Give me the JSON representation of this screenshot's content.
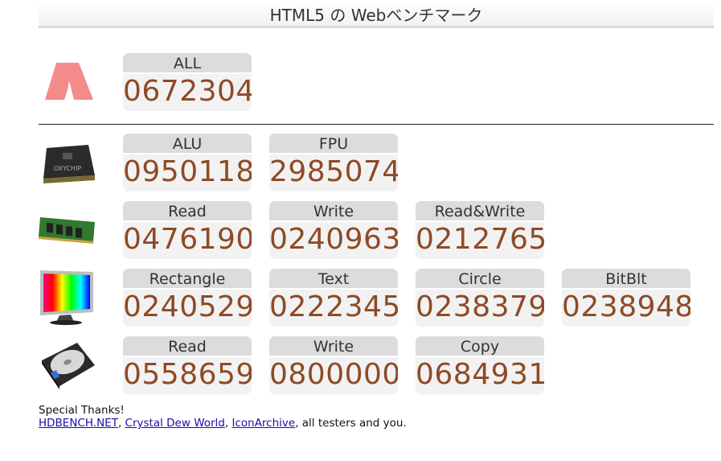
{
  "header": {
    "title": "HTML5 の Webベンチマーク"
  },
  "all": {
    "card": {
      "label": "ALL",
      "value": "0672304"
    }
  },
  "cpu": {
    "icon": "cpu-chip-icon",
    "cards": [
      {
        "label": "ALU",
        "value": "0950118"
      },
      {
        "label": "FPU",
        "value": "2985074"
      }
    ]
  },
  "memory": {
    "icon": "memory-module-icon",
    "cards": [
      {
        "label": "Read",
        "value": "0476190"
      },
      {
        "label": "Write",
        "value": "0240963"
      },
      {
        "label": "Read&Write",
        "value": "0212765"
      }
    ]
  },
  "video": {
    "icon": "monitor-icon",
    "cards": [
      {
        "label": "Rectangle",
        "value": "0240529"
      },
      {
        "label": "Text",
        "value": "0222345"
      },
      {
        "label": "Circle",
        "value": "0238379"
      },
      {
        "label": "BitBlt",
        "value": "0238948"
      }
    ]
  },
  "disk": {
    "icon": "hard-drive-icon",
    "cards": [
      {
        "label": "Read",
        "value": "0558659"
      },
      {
        "label": "Write",
        "value": "0800000"
      },
      {
        "label": "Copy",
        "value": "0684931"
      }
    ]
  },
  "thanks": {
    "line1": "Special Thanks!",
    "links": [
      "HDBENCH.NET",
      "Crystal Dew World",
      "IconArchive"
    ],
    "separator": ", ",
    "tail": ", all testers and you."
  },
  "colors": {
    "value": "#8e4a26",
    "label_bg": "#dcdcdc",
    "card_bg": "#f2f2f2",
    "logo": "#f48a8a"
  }
}
